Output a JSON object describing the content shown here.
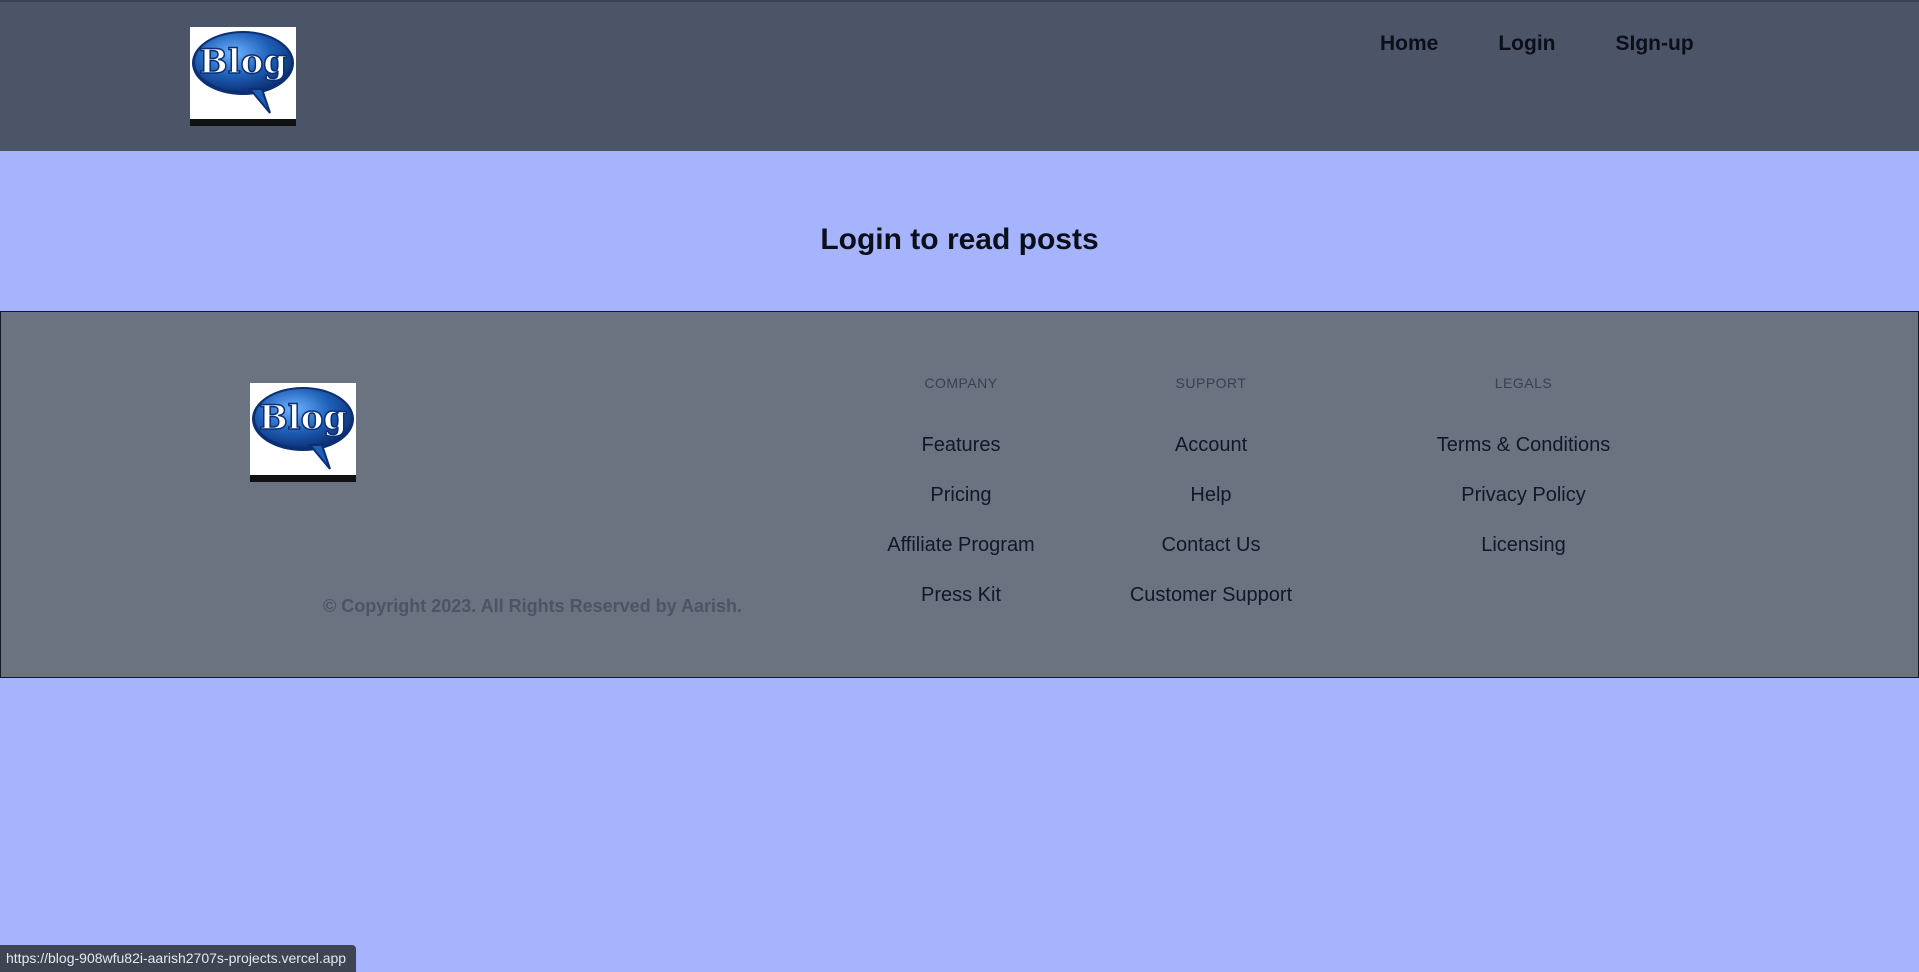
{
  "header": {
    "logo_text": "Blog",
    "nav": [
      {
        "label": "Home"
      },
      {
        "label": "Login"
      },
      {
        "label": "SIgn-up"
      }
    ]
  },
  "banner": {
    "title": "Login to read posts"
  },
  "footer": {
    "logo_text": "Blog",
    "copyright": "© Copyright 2023. All Rights Reserved by Aarish.",
    "columns": [
      {
        "heading": "COMPANY",
        "links": [
          "Features",
          "Pricing",
          "Affiliate Program",
          "Press Kit"
        ]
      },
      {
        "heading": "SUPPORT",
        "links": [
          "Account",
          "Help",
          "Contact Us",
          "Customer Support"
        ]
      },
      {
        "heading": "LEGALS",
        "links": [
          "Terms & Conditions",
          "Privacy Policy",
          "Licensing"
        ]
      }
    ]
  },
  "status_bar": {
    "url": "https://blog-908wfu82i-aarish2707s-projects.vercel.app"
  },
  "colors": {
    "header_bg": "#4b5567",
    "page_bg": "#a5b4fc",
    "footer_bg": "#6b7280",
    "logo_blue": "#1e5fb8"
  }
}
